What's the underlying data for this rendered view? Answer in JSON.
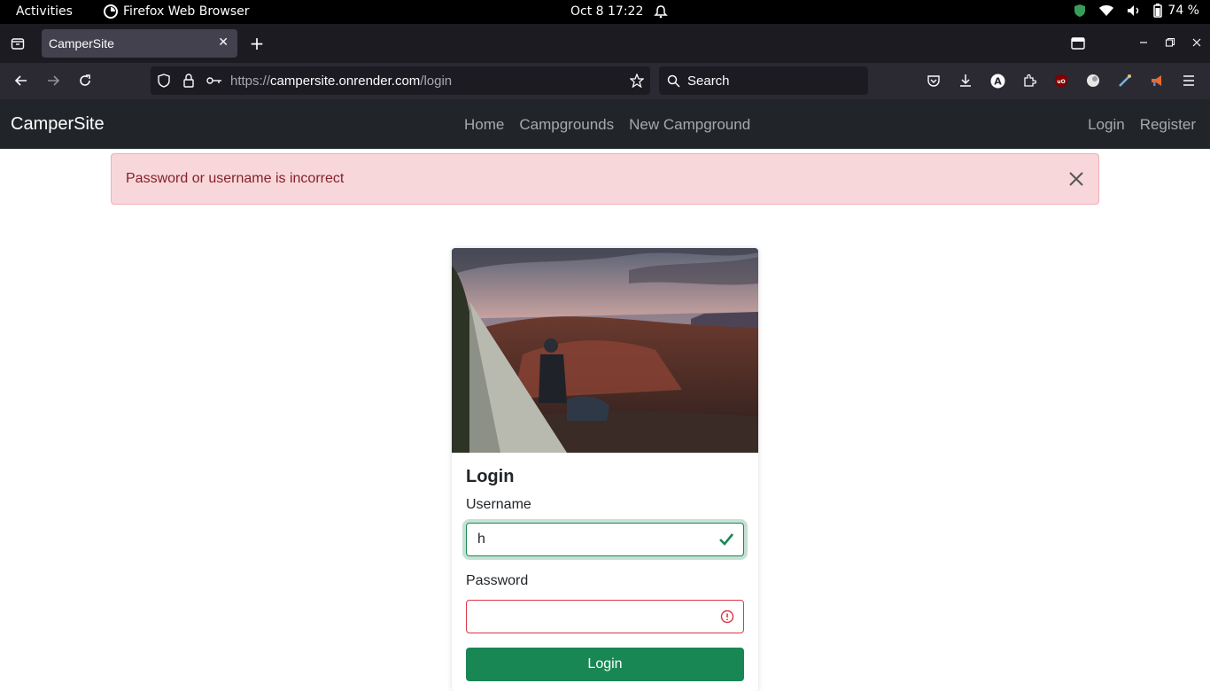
{
  "system_bar": {
    "activities": "Activities",
    "app_name": "Firefox Web Browser",
    "clock": "Oct 8  17:22",
    "battery": "74 %"
  },
  "browser": {
    "tab_title": "CamperSite",
    "url_scheme": "https://",
    "url_host": "campersite.onrender.com",
    "url_path": "/login",
    "search_placeholder": "Search"
  },
  "site": {
    "brand": "CamperSite",
    "nav_links": [
      "Home",
      "Campgrounds",
      "New Campground"
    ],
    "auth_links": [
      "Login",
      "Register"
    ]
  },
  "alert": {
    "message": "Password or username is incorrect"
  },
  "login_card": {
    "title": "Login",
    "username_label": "Username",
    "username_value": "h",
    "password_label": "Password",
    "password_value": "",
    "submit_label": "Login"
  },
  "colors": {
    "success": "#198754",
    "danger": "#dc3545",
    "alert_bg": "#f8d7da",
    "navbar_bg": "#212529"
  }
}
